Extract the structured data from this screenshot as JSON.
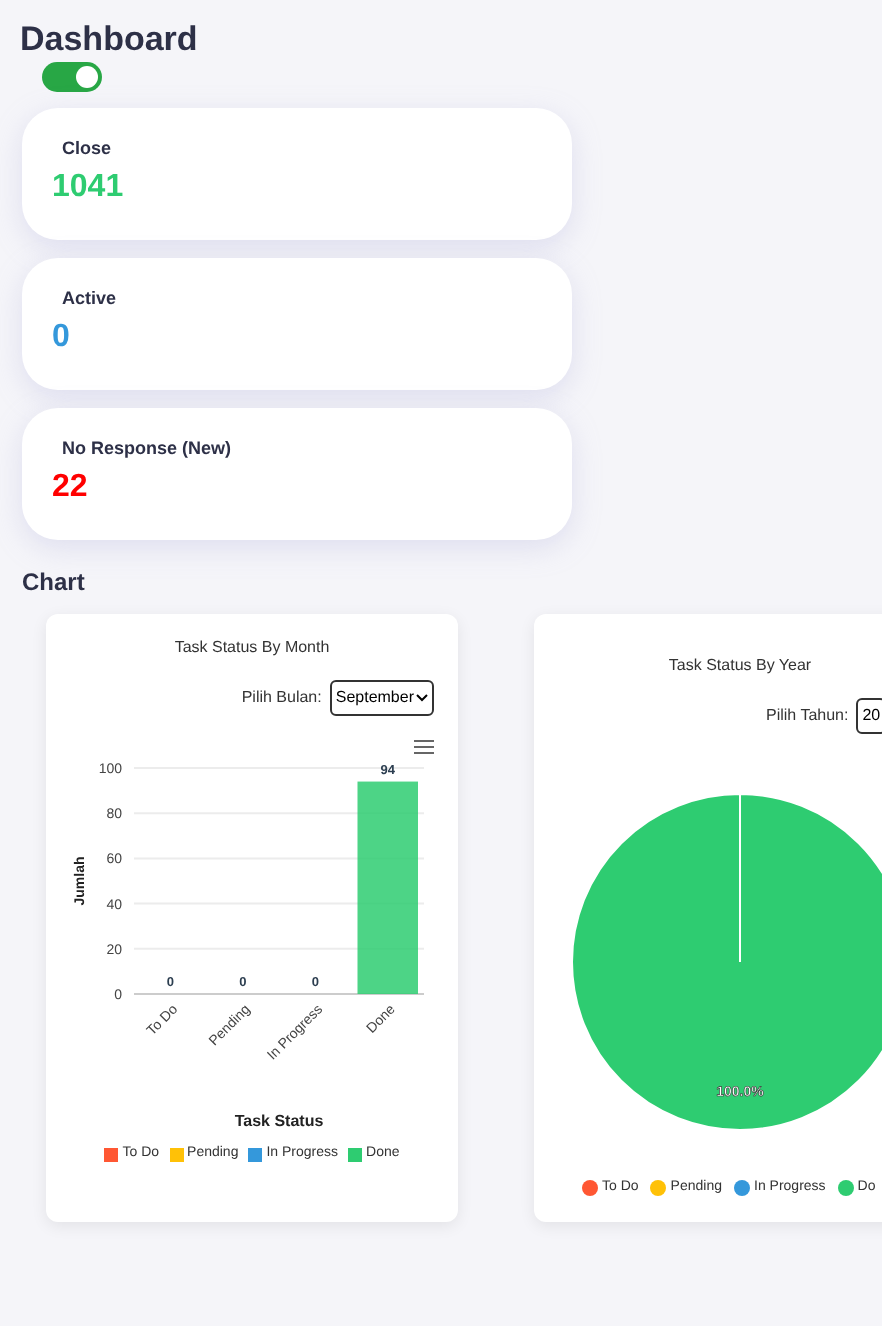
{
  "title": "Dashboard",
  "toggle": {
    "on": true
  },
  "stats": [
    {
      "label": "Close",
      "value": "1041",
      "color": "#2ecc71"
    },
    {
      "label": "Active",
      "value": "0",
      "color": "#3498db"
    },
    {
      "label": "No Response (New)",
      "value": "22",
      "color": "#ff0000"
    }
  ],
  "section_title": "Chart",
  "month_chart": {
    "title": "Task Status By Month",
    "picker_label": "Pilih Bulan:",
    "picker_value": "September",
    "chart_data": {
      "type": "bar",
      "xlabel": "Task Status",
      "ylabel": "Jumlah",
      "categories": [
        "To Do",
        "Pending",
        "In Progress",
        "Done"
      ],
      "values": [
        0,
        0,
        0,
        94
      ],
      "ylim": [
        0,
        100
      ],
      "yticks": [
        0,
        20,
        40,
        60,
        80,
        100
      ],
      "grid": true,
      "data_labels": true
    },
    "legend": [
      {
        "color": "#ff5733"
      },
      {
        "color": "#ffc107"
      },
      {
        "color": "#3498db"
      },
      {
        "color": "#2ecc71"
      }
    ]
  },
  "year_chart": {
    "title": "Task Status By Year",
    "picker_label": "Pilih Tahun:",
    "picker_value": "20",
    "chart_data": {
      "type": "pie",
      "categories": [
        "To Do",
        "Pending",
        "In Progress",
        "Do"
      ],
      "values": [
        0,
        0,
        0,
        100
      ],
      "value_labels": [
        null,
        null,
        null,
        "100.0%"
      ]
    },
    "legend": [
      {
        "color": "#ff5733"
      },
      {
        "color": "#ffc107"
      },
      {
        "color": "#3498db"
      },
      {
        "color": "#2ecc71"
      }
    ]
  }
}
